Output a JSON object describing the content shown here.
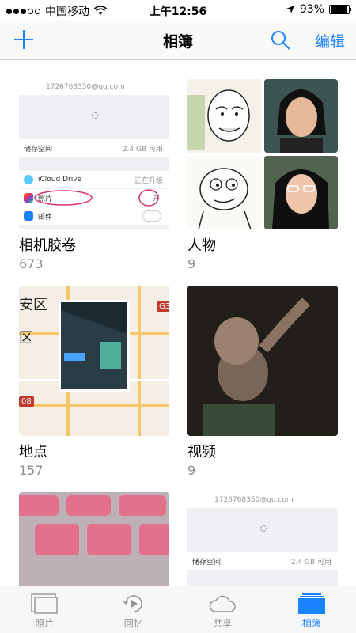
{
  "status_bar": {
    "carrier": "中国移动",
    "time": "上午12:56",
    "battery": "93%",
    "battery_level": 0.93
  },
  "nav": {
    "title": "相簿",
    "edit_label": "编辑"
  },
  "albums": [
    {
      "name": "相机胶卷",
      "count": "673"
    },
    {
      "name": "人物",
      "count": "9"
    },
    {
      "name": "地点",
      "count": "157"
    },
    {
      "name": "视频",
      "count": "9"
    }
  ],
  "thumb_text": {
    "email": "1726768350@qq.com",
    "storage_label": "储存空间",
    "storage_value": "2.4 GB 可用",
    "icloud": "iCloud Drive",
    "icloud_status": "正在升级",
    "photos": "照片",
    "photos_value": "开",
    "mail": "邮件"
  },
  "map": {
    "label_top": "安区",
    "label_mid": "区",
    "road_badge": "G3",
    "road_badge_left": "08"
  },
  "tabs": [
    {
      "label": "照片",
      "icon": "photos-icon"
    },
    {
      "label": "回忆",
      "icon": "memories-icon"
    },
    {
      "label": "共享",
      "icon": "cloud-icon"
    },
    {
      "label": "相簿",
      "icon": "albums-icon"
    }
  ],
  "colors": {
    "accent": "#1a84ff",
    "secondary_text": "#8e8e93"
  }
}
